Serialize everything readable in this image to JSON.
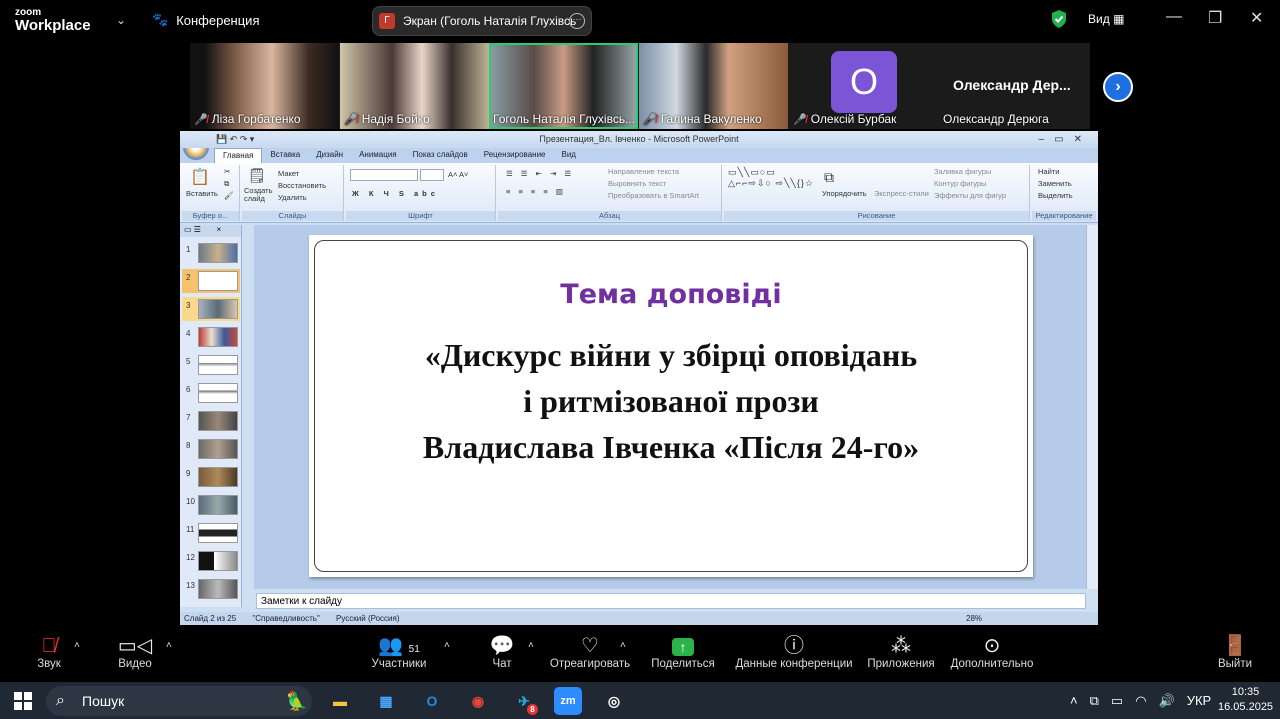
{
  "topbar": {
    "brand_small": "zoom",
    "brand_big": "Workplace",
    "conference_label": "Конференция",
    "screen_share_title": "Экран (Гоголь Наталія Глухівсь",
    "screen_share_initial": "Г",
    "view_label": "Вид"
  },
  "participants": [
    {
      "name": "Ліза Горбатенко",
      "muted": true
    },
    {
      "name": "Надія Бойко",
      "muted": true
    },
    {
      "name": "Гоголь Наталія Глухівсь...",
      "muted": false,
      "active": true
    },
    {
      "name": "Галина Вакуленко",
      "muted": true
    },
    {
      "name": "Олексій Бурбак",
      "muted": true,
      "avatar_letter": "О"
    },
    {
      "name": "Олександр Дерюга",
      "muted": false,
      "display_name_big": "Олександр  Дер..."
    }
  ],
  "ppt": {
    "window_title": "Презентация_Вл. Івченко - Microsoft PowerPoint",
    "tabs": [
      "Главная",
      "Вставка",
      "Дизайн",
      "Анимация",
      "Показ слайдов",
      "Рецензирование",
      "Вид"
    ],
    "groups": {
      "clipboard": "Буфер о...",
      "slides": "Слайды",
      "font": "Шрифт",
      "paragraph": "Абзац",
      "drawing": "Рисование",
      "editing": "Редактирование"
    },
    "ribbon": {
      "paste": "Вставить",
      "create_slide": "Создать слайд",
      "layout": "Макет",
      "reset": "Восстановить",
      "delete": "Удалить",
      "text_direction": "Направление текста",
      "align_text": "Выровнять текст",
      "smartart": "Преобразовать в SmartArt",
      "arrange": "Упорядочить",
      "quick_styles": "Экспресс-стили",
      "shape_fill": "Заливка фигуры",
      "shape_outline": "Контур фигуры",
      "shape_effects": "Эффекты для фигур",
      "find": "Найти",
      "replace": "Заменить",
      "select": "Выделить"
    },
    "slide": {
      "heading": "Тема доповіді",
      "body_line1": "«Дискурс війни у збірці оповідань",
      "body_line2": "і ритмізованої прози",
      "body_line3": "Владислава Івченка «Після 24-го»"
    },
    "thumb_numbers": [
      "1",
      "2",
      "3",
      "4",
      "5",
      "6",
      "7",
      "8",
      "9",
      "10",
      "11",
      "12",
      "13"
    ],
    "notes_placeholder": "Заметки к слайду",
    "status": {
      "slide_of": "Слайд 2 из 25",
      "theme": "\"Справедливость\"",
      "language": "Русский (Россия)",
      "zoom": "28%"
    }
  },
  "toolbar": {
    "audio": "Звук",
    "video": "Видео",
    "participants": "Участники",
    "participants_count": "51",
    "chat": "Чат",
    "react": "Отреагировать",
    "share": "Поделиться",
    "meeting_info": "Данные конференции",
    "apps": "Приложения",
    "more": "Дополнительно",
    "leave": "Выйти"
  },
  "taskbar": {
    "search_placeholder": "Пошук",
    "language": "УКР",
    "time": "10:35",
    "date": "16.05.2025",
    "telegram_badge": "8"
  }
}
